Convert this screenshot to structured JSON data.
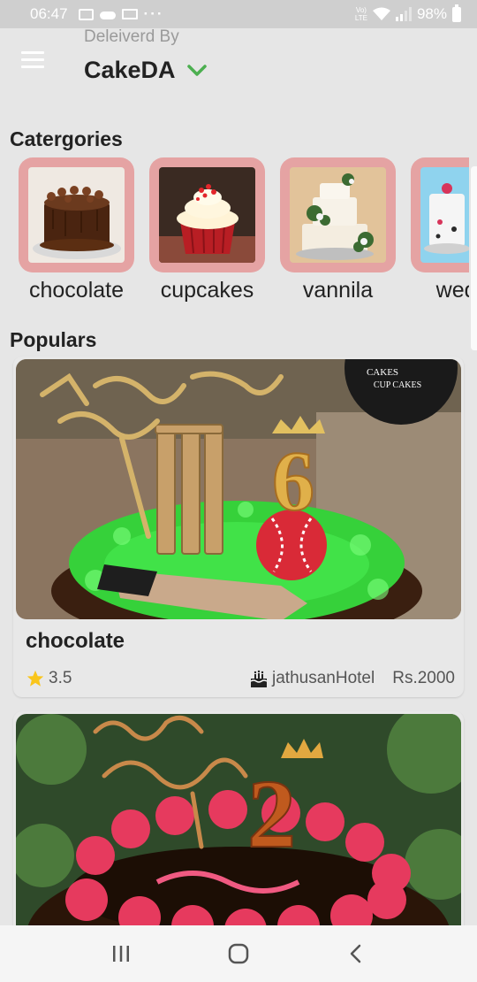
{
  "status_bar": {
    "time": "06:47",
    "more": "···",
    "volte_top": "Vo)",
    "volte_bottom": "LTE",
    "battery": "98%"
  },
  "header": {
    "delivered_by": "Deleiverd By",
    "brand": "CakeDA"
  },
  "categories_title": "Catergories",
  "categories": [
    {
      "label": "chocolate"
    },
    {
      "label": "cupcakes"
    },
    {
      "label": "vannila"
    },
    {
      "label": "weddir"
    }
  ],
  "populars_title": "Populars",
  "populars": [
    {
      "name": "chocolate",
      "rating": "3.5",
      "hotel": "jathusanHotel",
      "price": "Rs.2000",
      "image_text_1": "CAKES",
      "image_text_2": "CUP CAKES"
    },
    {
      "name": "",
      "rating": "",
      "hotel": "",
      "price": ""
    }
  ],
  "colors": {
    "accent_green": "#4caf50",
    "category_frame": "#e5a3a3",
    "star": "#f9c51b"
  },
  "icons": [
    "menu-icon",
    "chevron-down-icon",
    "star-icon",
    "cake-icon",
    "recent-apps-icon",
    "home-icon",
    "back-icon"
  ]
}
